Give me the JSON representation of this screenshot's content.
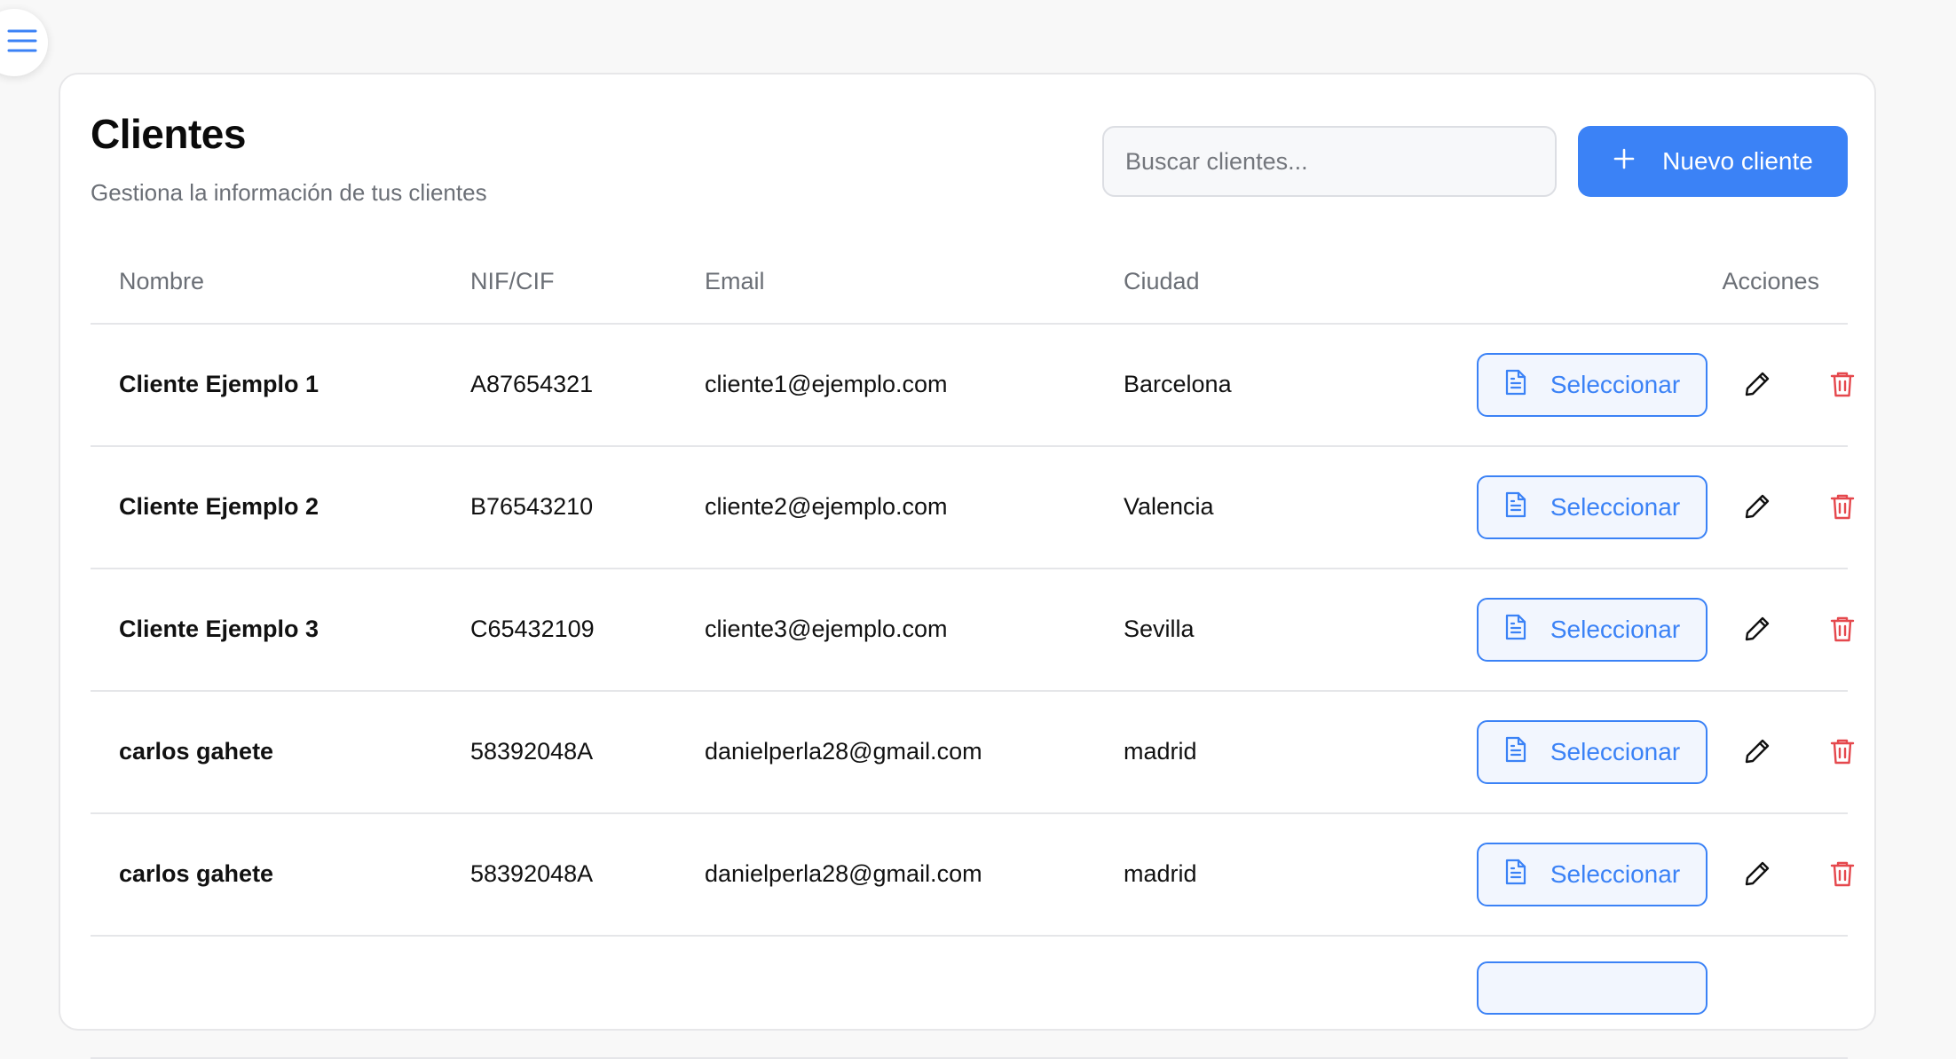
{
  "header": {
    "title": "Clientes",
    "subtitle": "Gestiona la información de tus clientes",
    "search_placeholder": "Buscar clientes...",
    "new_button_label": "Nuevo cliente"
  },
  "table": {
    "columns": [
      "Nombre",
      "NIF/CIF",
      "Email",
      "Ciudad",
      "Acciones"
    ],
    "select_label": "Seleccionar",
    "rows": [
      {
        "name": "Cliente Ejemplo 1",
        "nif": "A87654321",
        "email": "cliente1@ejemplo.com",
        "city": "Barcelona"
      },
      {
        "name": "Cliente Ejemplo 2",
        "nif": "B76543210",
        "email": "cliente2@ejemplo.com",
        "city": "Valencia"
      },
      {
        "name": "Cliente Ejemplo 3",
        "nif": "C65432109",
        "email": "cliente3@ejemplo.com",
        "city": "Sevilla"
      },
      {
        "name": "carlos gahete",
        "nif": "58392048A",
        "email": "danielperla28@gmail.com",
        "city": "madrid"
      },
      {
        "name": "carlos gahete",
        "nif": "58392048A",
        "email": "danielperla28@gmail.com",
        "city": "madrid"
      }
    ]
  },
  "colors": {
    "accent": "#3b82f6",
    "danger": "#e5484d",
    "muted_text": "#6b6f76"
  },
  "icons": {
    "menu": "hamburger-menu-icon",
    "new": "plus-icon",
    "select": "document-icon",
    "edit": "pencil-icon",
    "delete": "trash-icon"
  }
}
